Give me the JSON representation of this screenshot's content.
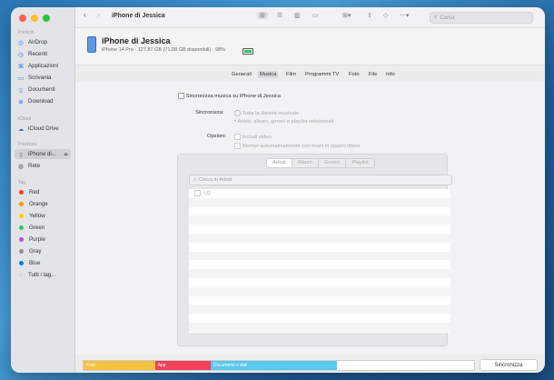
{
  "sidebar": {
    "preferiti_title": "Preferiti",
    "favorites": [
      {
        "label": "AirDrop",
        "icon": "airdrop-icon"
      },
      {
        "label": "Recenti",
        "icon": "clock-icon"
      },
      {
        "label": "Applicazioni",
        "icon": "apps-icon"
      },
      {
        "label": "Scrivania",
        "icon": "desktop-icon"
      },
      {
        "label": "Documenti",
        "icon": "document-icon"
      },
      {
        "label": "Download",
        "icon": "download-icon"
      }
    ],
    "icloud_title": "iCloud",
    "icloud": [
      {
        "label": "iCloud Drive",
        "icon": "cloud-icon"
      }
    ],
    "posizioni_title": "Posizioni",
    "locations": [
      {
        "label": "iPhone di...",
        "icon": "iphone-icon",
        "selected": true
      },
      {
        "label": "Rete",
        "icon": "network-icon"
      }
    ],
    "tag_title": "Tag",
    "tags": [
      {
        "label": "Red",
        "color": "#ff3b30"
      },
      {
        "label": "Orange",
        "color": "#ff9500"
      },
      {
        "label": "Yellow",
        "color": "#ffcc00"
      },
      {
        "label": "Green",
        "color": "#34c759"
      },
      {
        "label": "Purple",
        "color": "#af52de"
      },
      {
        "label": "Gray",
        "color": "#8e8e93"
      },
      {
        "label": "Blue",
        "color": "#007aff"
      }
    ],
    "all_tags": "Tutti i tag..."
  },
  "toolbar": {
    "title": "iPhone di Jessica",
    "search_placeholder": "Cerca"
  },
  "device": {
    "name": "iPhone di Jessica",
    "info": "iPhone 14 Pro · 127,87 GB (71,08 GB disponibili) · 98%",
    "battery_level": 0.98,
    "battery_color": "#33c25a"
  },
  "tabs": [
    "Generali",
    "Musica",
    "Film",
    "Programmi TV",
    "Foto",
    "File",
    "Info"
  ],
  "selected_tab": "Musica",
  "music": {
    "sync_label": "Sincronizza musica su iPhone di Jessica",
    "sync_heading": "Sincronizza:",
    "sync_options": [
      "Tutta la libreria musicale",
      "Artisti, album, generi e playlist selezionati"
    ],
    "options_heading": "Opzioni:",
    "options": [
      "Includi video",
      "Riempi automaticamente con brani in spazio libero"
    ],
    "segments": [
      "Artisti",
      "Album",
      "Generi",
      "Playlist"
    ],
    "artist_search_placeholder": "Cerca in Artisti",
    "artists": [
      "U2"
    ]
  },
  "storage": {
    "segments": [
      {
        "label": "Foto",
        "color": "#f5c242",
        "fraction": 0.183
      },
      {
        "label": "App",
        "color": "#f0405a",
        "fraction": 0.142
      },
      {
        "label": "Documenti e dati",
        "color": "#5ac8f0",
        "fraction": 0.325
      }
    ],
    "sync_button": "Sincronizza"
  }
}
